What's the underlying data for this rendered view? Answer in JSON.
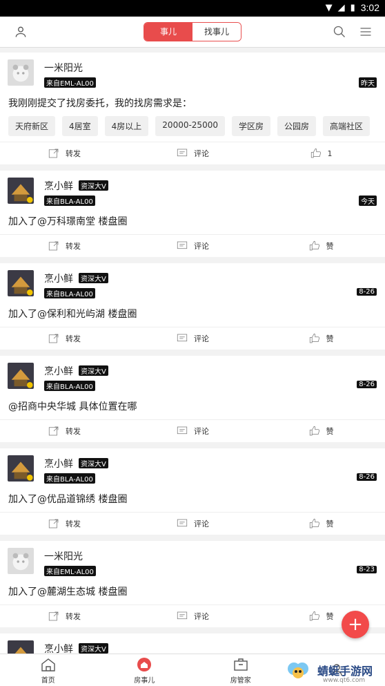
{
  "status_bar": {
    "time": "3:02"
  },
  "header": {
    "segmented": {
      "tab_active": "事儿",
      "tab_inactive": "找事儿"
    }
  },
  "posts": [
    {
      "name": "一米阳光",
      "source": "来自EML-AL00",
      "time": "昨天",
      "content": "我刚刚提交了找房委托，我的找房需求是：",
      "tags": [
        "天府新区",
        "4居室",
        "4房以上",
        "20000-25000",
        "学区房",
        "公园房",
        "高端社区"
      ],
      "actions": {
        "repost": "转发",
        "comment": "评论",
        "like": "1"
      },
      "badge": ""
    },
    {
      "name": "烹小鲜",
      "badge": "资深大V",
      "source": "来自BLA-AL00",
      "time": "今天",
      "content": "加入了@万科璟南堂 楼盘圈",
      "actions": {
        "repost": "转发",
        "comment": "评论",
        "like": "赞"
      }
    },
    {
      "name": "烹小鲜",
      "badge": "资深大V",
      "source": "来自BLA-AL00",
      "time": "8-26",
      "content": "加入了@保利和光屿湖 楼盘圈",
      "actions": {
        "repost": "转发",
        "comment": "评论",
        "like": "赞"
      }
    },
    {
      "name": "烹小鲜",
      "badge": "资深大V",
      "source": "来自BLA-AL00",
      "time": "8-26",
      "content": "@招商中央华城 具体位置在哪",
      "actions": {
        "repost": "转发",
        "comment": "评论",
        "like": "赞"
      }
    },
    {
      "name": "烹小鲜",
      "badge": "资深大V",
      "source": "来自BLA-AL00",
      "time": "8-26",
      "content": "加入了@优品道锦绣 楼盘圈",
      "actions": {
        "repost": "转发",
        "comment": "评论",
        "like": "赞"
      }
    },
    {
      "name": "一米阳光",
      "badge": "",
      "source": "来自EML-AL00",
      "time": "8-23",
      "content": "加入了@麓湖生态城 楼盘圈",
      "actions": {
        "repost": "转发",
        "comment": "评论",
        "like": "赞"
      }
    },
    {
      "name": "烹小鲜",
      "badge": "资深大V"
    }
  ],
  "fab": {
    "icon": "plus"
  },
  "bottom_nav": [
    {
      "label": "首页",
      "icon": "home-icon"
    },
    {
      "label": "房事儿",
      "icon": "house-badge-icon"
    },
    {
      "label": "房管家",
      "icon": "briefcase-icon"
    },
    {
      "label": "",
      "icon": "profile-icon"
    }
  ],
  "watermark": {
    "title": "蜻蜓手游网",
    "url": "www.qt6.com"
  },
  "colors": {
    "accent": "#e84c4c",
    "fab": "#f24a4a"
  }
}
